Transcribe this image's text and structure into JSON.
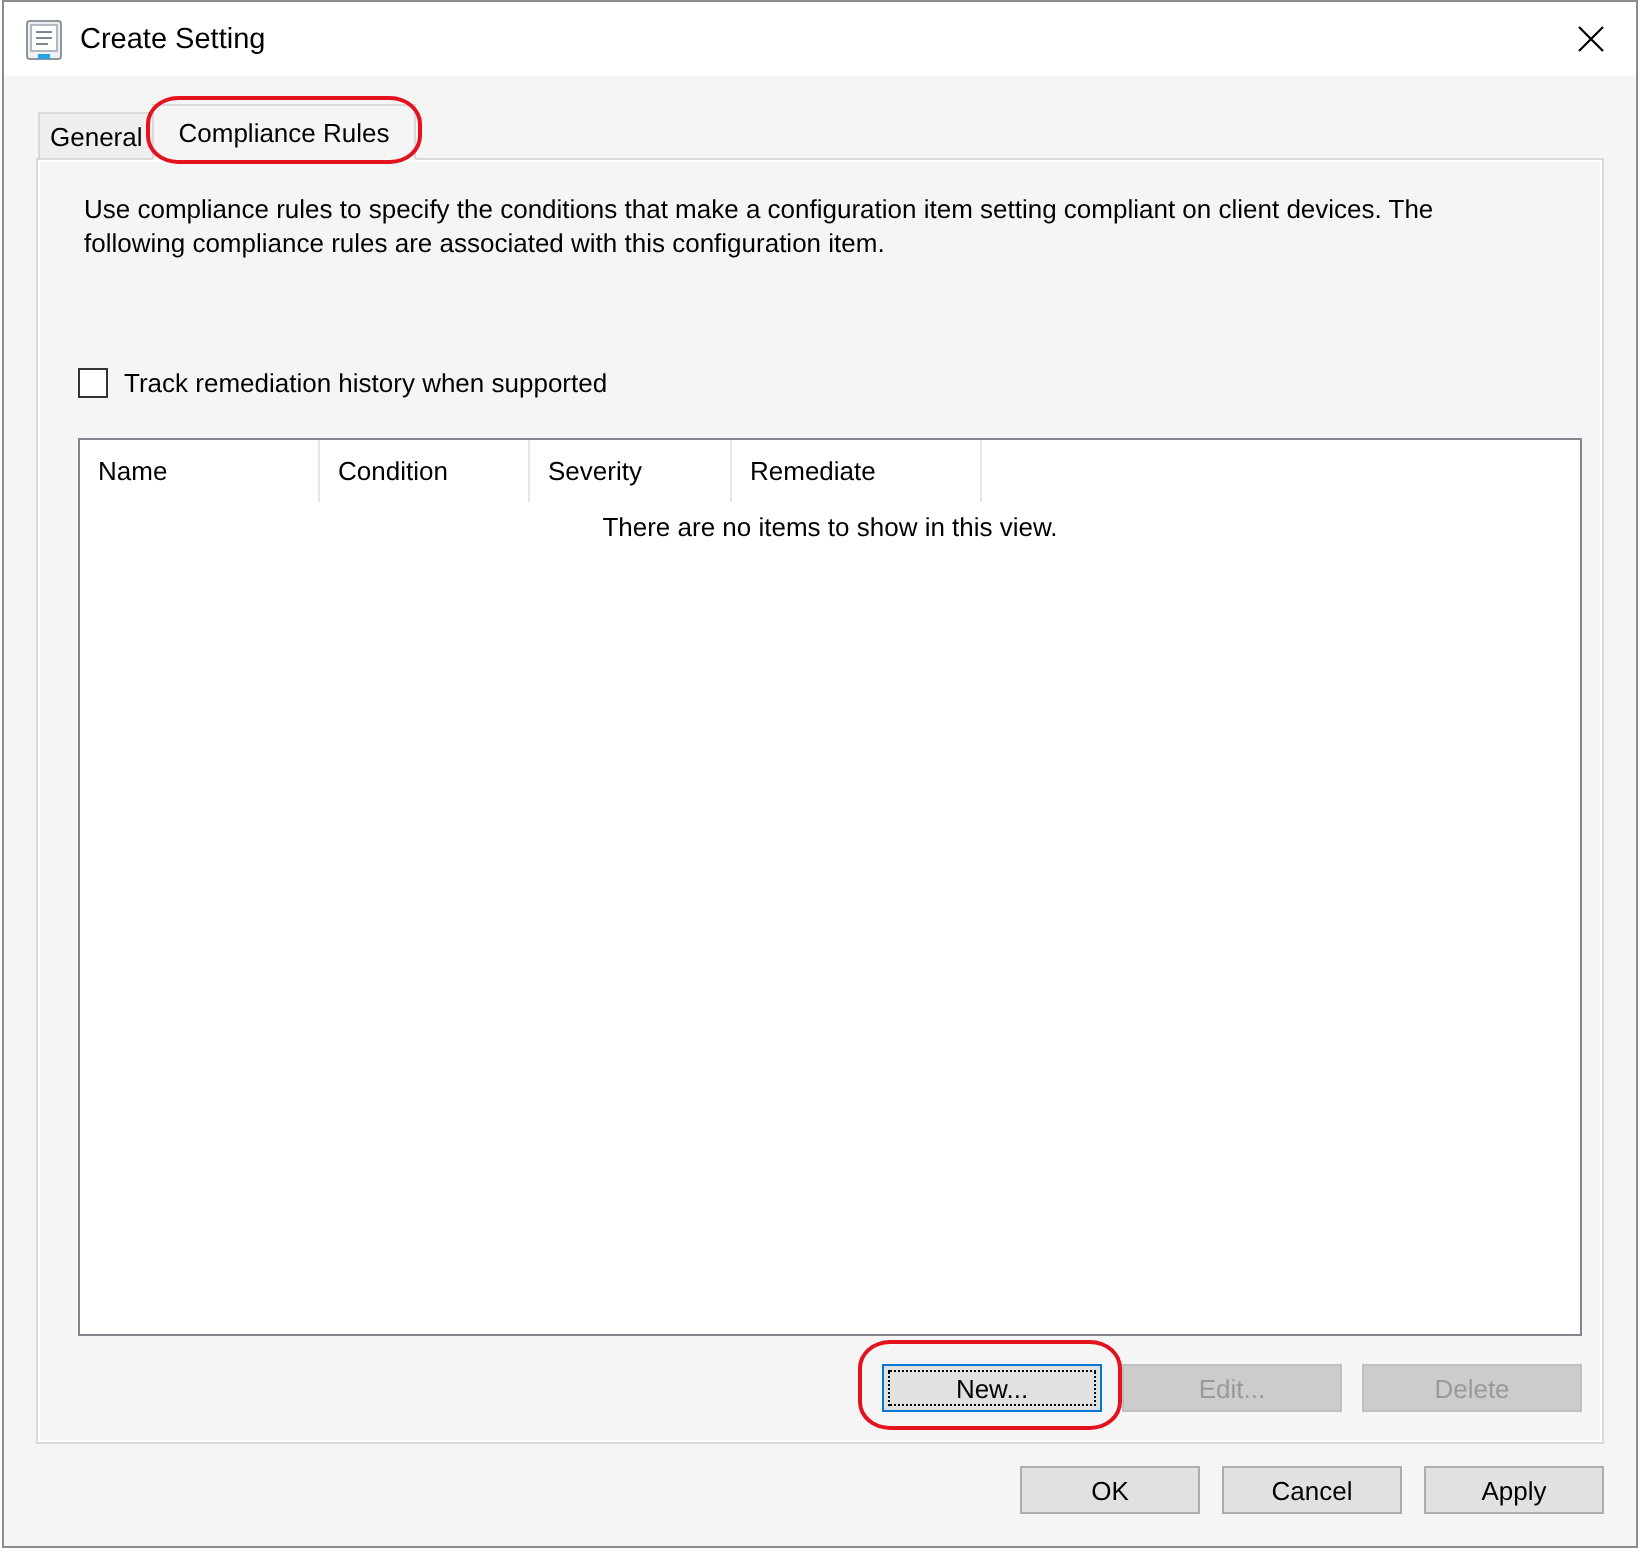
{
  "window": {
    "title": "Create Setting"
  },
  "tabs": [
    {
      "label": "General",
      "selected": false,
      "highlighted": false
    },
    {
      "label": "Compliance Rules",
      "selected": true,
      "highlighted": true
    }
  ],
  "description": "Use compliance rules to specify the conditions that make a configuration item setting compliant on client devices. The following compliance rules are associated with this configuration item.",
  "track_history": {
    "label": "Track remediation history when supported",
    "checked": false
  },
  "rules_list": {
    "columns": [
      "Name",
      "Condition",
      "Severity",
      "Remediate"
    ],
    "empty_message": "There are no items to show in this view."
  },
  "list_buttons": [
    {
      "label": "New...",
      "disabled": false,
      "focused": true,
      "highlighted": true
    },
    {
      "label": "Edit...",
      "disabled": true,
      "focused": false,
      "highlighted": false
    },
    {
      "label": "Delete",
      "disabled": true,
      "focused": false,
      "highlighted": false
    }
  ],
  "dialog_buttons": [
    {
      "label": "OK"
    },
    {
      "label": "Cancel"
    },
    {
      "label": "Apply"
    }
  ]
}
